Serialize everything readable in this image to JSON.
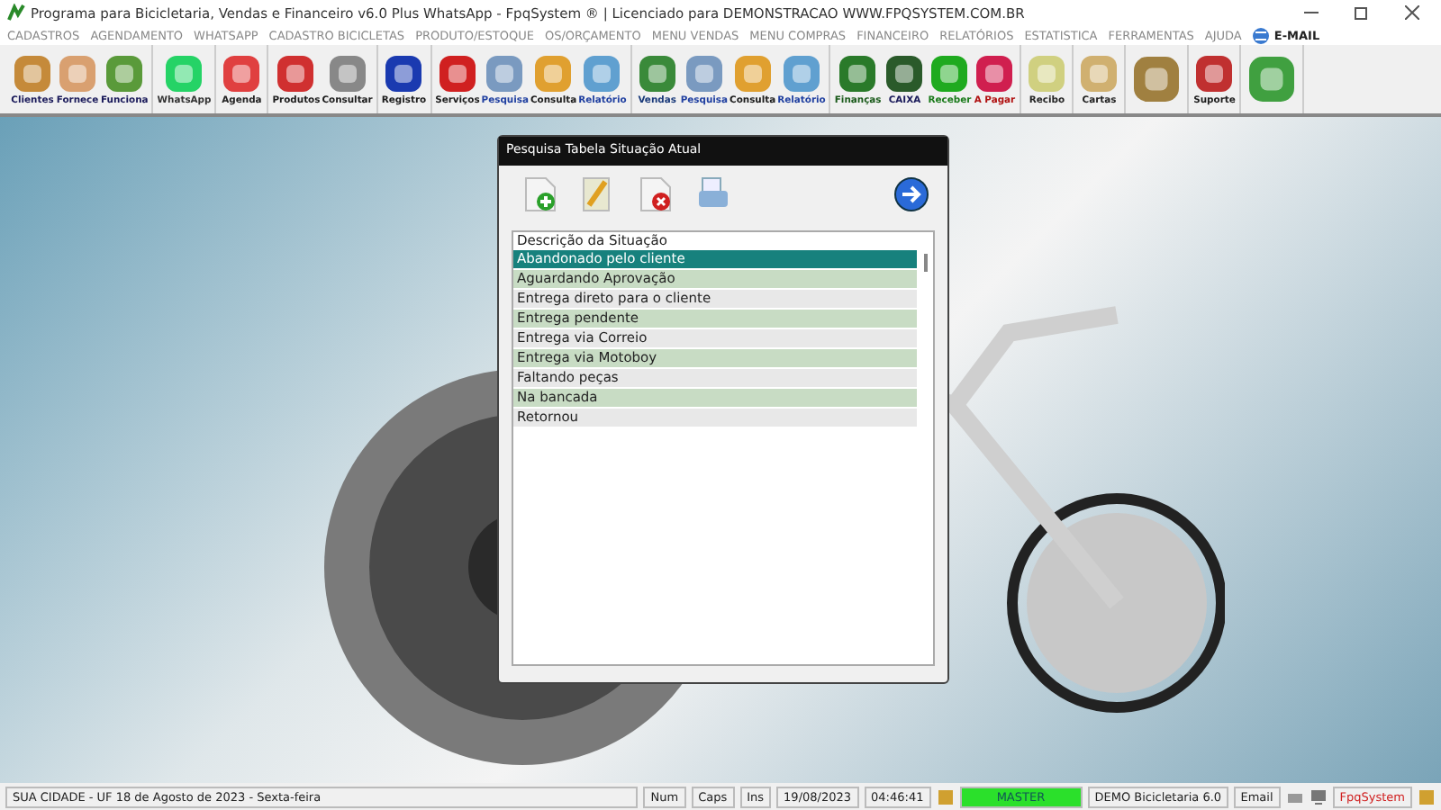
{
  "window": {
    "title": "Programa para Bicicletaria, Vendas e Financeiro v6.0 Plus WhatsApp - FpqSystem ® | Licenciado para  DEMONSTRACAO WWW.FPQSYSTEM.COM.BR"
  },
  "menu": [
    "CADASTROS",
    "AGENDAMENTO",
    "WHATSAPP",
    "CADASTRO BICICLETAS",
    "PRODUTO/ESTOQUE",
    "OS/ORÇAMENTO",
    "MENU VENDAS",
    "MENU COMPRAS",
    "FINANCEIRO",
    "RELATÓRIOS",
    "ESTATISTICA",
    "FERRAMENTAS",
    "AJUDA"
  ],
  "email_menu": "E-MAIL",
  "toolbar": [
    {
      "group": [
        {
          "label": "Clientes",
          "color": "#1a1a5a"
        },
        {
          "label": "Fornece",
          "color": "#1a1a5a"
        },
        {
          "label": "Funciona",
          "color": "#1a1a5a"
        }
      ]
    },
    {
      "group": [
        {
          "label": "WhatsApp",
          "color": "#333333"
        }
      ]
    },
    {
      "group": [
        {
          "label": "Agenda",
          "color": "#222222"
        }
      ]
    },
    {
      "group": [
        {
          "label": "Produtos",
          "color": "#1a1a1a"
        },
        {
          "label": "Consultar",
          "color": "#1a1a1a"
        }
      ]
    },
    {
      "group": [
        {
          "label": "Registro",
          "color": "#1a1a1a"
        }
      ]
    },
    {
      "group": [
        {
          "label": "Serviços",
          "color": "#1a1a1a"
        },
        {
          "label": "Pesquisa",
          "color": "#1f3fa0"
        },
        {
          "label": "Consulta",
          "color": "#1a1a1a"
        },
        {
          "label": "Relatório",
          "color": "#1f3fa0"
        }
      ]
    },
    {
      "group": [
        {
          "label": "Vendas",
          "color": "#1a3a7a"
        },
        {
          "label": "Pesquisa",
          "color": "#1f3fa0"
        },
        {
          "label": "Consulta",
          "color": "#1a1a1a"
        },
        {
          "label": "Relatório",
          "color": "#1f3fa0"
        }
      ]
    },
    {
      "group": [
        {
          "label": "Finanças",
          "color": "#1a5a1a"
        },
        {
          "label": "CAIXA",
          "color": "#1a1a5a"
        },
        {
          "label": "Receber",
          "color": "#1a7a1a"
        },
        {
          "label": "A Pagar",
          "color": "#b01010"
        }
      ]
    },
    {
      "group": [
        {
          "label": "Recibo",
          "color": "#222222"
        }
      ]
    },
    {
      "group": [
        {
          "label": "Cartas",
          "color": "#222222"
        }
      ]
    },
    {
      "group": [
        {
          "kind": "icon"
        }
      ]
    },
    {
      "group": [
        {
          "label": "Suporte",
          "color": "#1a1a1a"
        }
      ]
    },
    {
      "group": [
        {
          "kind": "icon"
        }
      ]
    }
  ],
  "dialog": {
    "title": "Pesquisa Tabela Situação Atual",
    "column": "Descrição da Situação",
    "rows": [
      {
        "text": "Abandonado pelo cliente",
        "selected": true
      },
      {
        "text": "Aguardando Aprovação",
        "selected": false
      },
      {
        "text": "Entrega direto para o cliente",
        "selected": false
      },
      {
        "text": "Entrega pendente",
        "selected": false
      },
      {
        "text": "Entrega via Correio",
        "selected": false
      },
      {
        "text": "Entrega via Motoboy",
        "selected": false
      },
      {
        "text": "Faltando peças",
        "selected": false
      },
      {
        "text": "Na bancada",
        "selected": false
      },
      {
        "text": "Retornou",
        "selected": false
      }
    ]
  },
  "status_bar": {
    "location": "SUA CIDADE - UF 18 de Agosto de 2023 - Sexta-feira",
    "num": "Num",
    "caps": "Caps",
    "ins": "Ins",
    "date": "19/08/2023",
    "time": "04:46:41",
    "user": "MASTER",
    "product": "DEMO Bicicletaria 6.0",
    "email": "Email",
    "brand": "FpqSystem"
  }
}
